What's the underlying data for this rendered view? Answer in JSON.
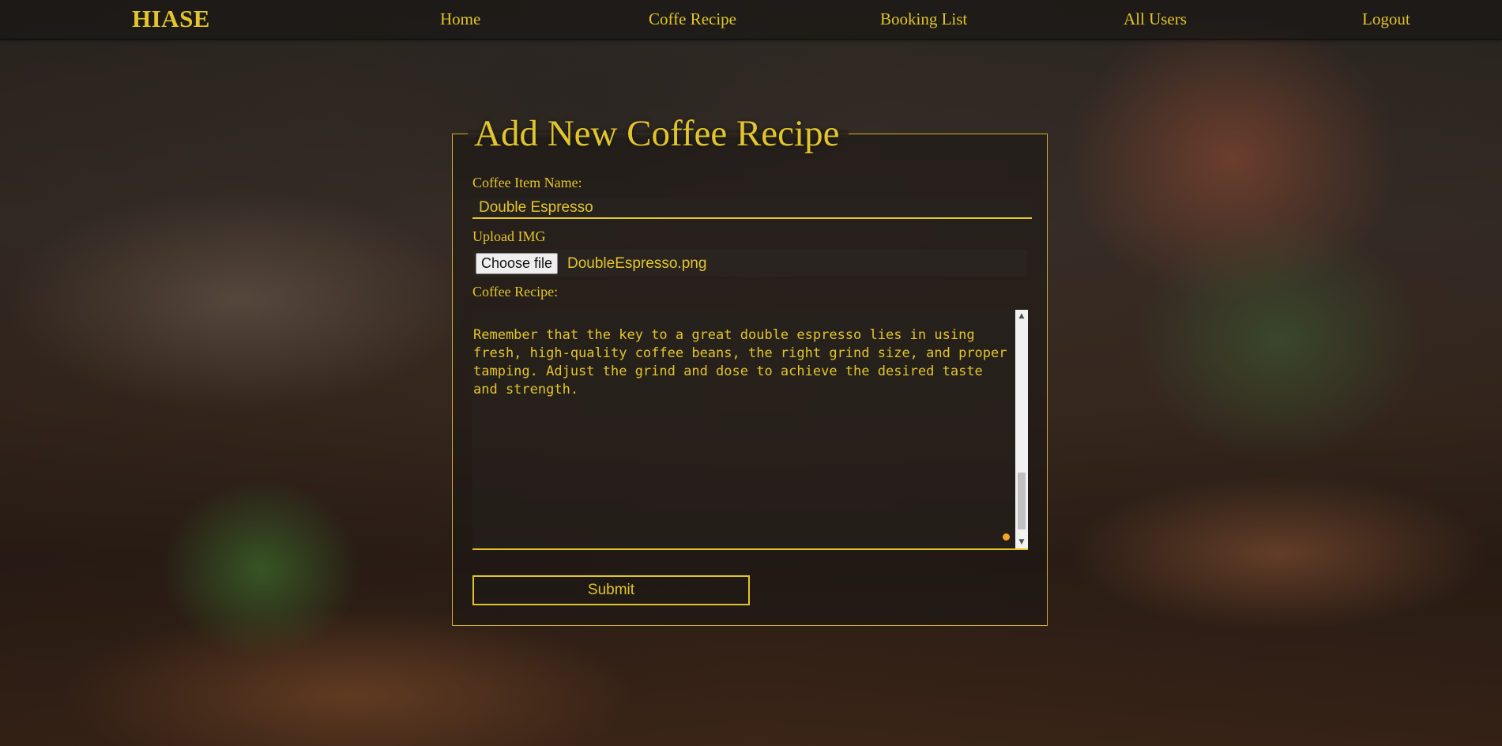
{
  "navbar": {
    "brand": "HIASE",
    "links": [
      {
        "label": "Home"
      },
      {
        "label": "Coffe Recipe"
      },
      {
        "label": "Booking List"
      },
      {
        "label": "All Users"
      },
      {
        "label": "Logout"
      }
    ]
  },
  "form": {
    "title": "Add New Coffee Recipe",
    "item_name_label": "Coffee Item Name:",
    "item_name_value": "Double Espresso",
    "upload_label": "Upload IMG",
    "file_button_label": "Choose file",
    "file_name": "DoubleEspresso.png",
    "recipe_label": "Coffee Recipe:",
    "recipe_text": "Serve Immediately:\n\nA double espresso is typically served in a small cup or shot glass. It's best enjoyed immediately to capture the full flavor and aroma of the concentrated coffee.\nOptional: Some people prefer a double espresso with a twist of lemon peel on the side. The citrus aroma complements the rich coffee flavors.\n\nRemember that the key to a great double espresso lies in using fresh, high-quality coffee beans, the right grind size, and proper tamping. Adjust the grind and dose to achieve the desired taste and strength.",
    "submit_label": "Submit"
  },
  "colors": {
    "accent": "#e2c52c",
    "border": "#d2b226"
  }
}
